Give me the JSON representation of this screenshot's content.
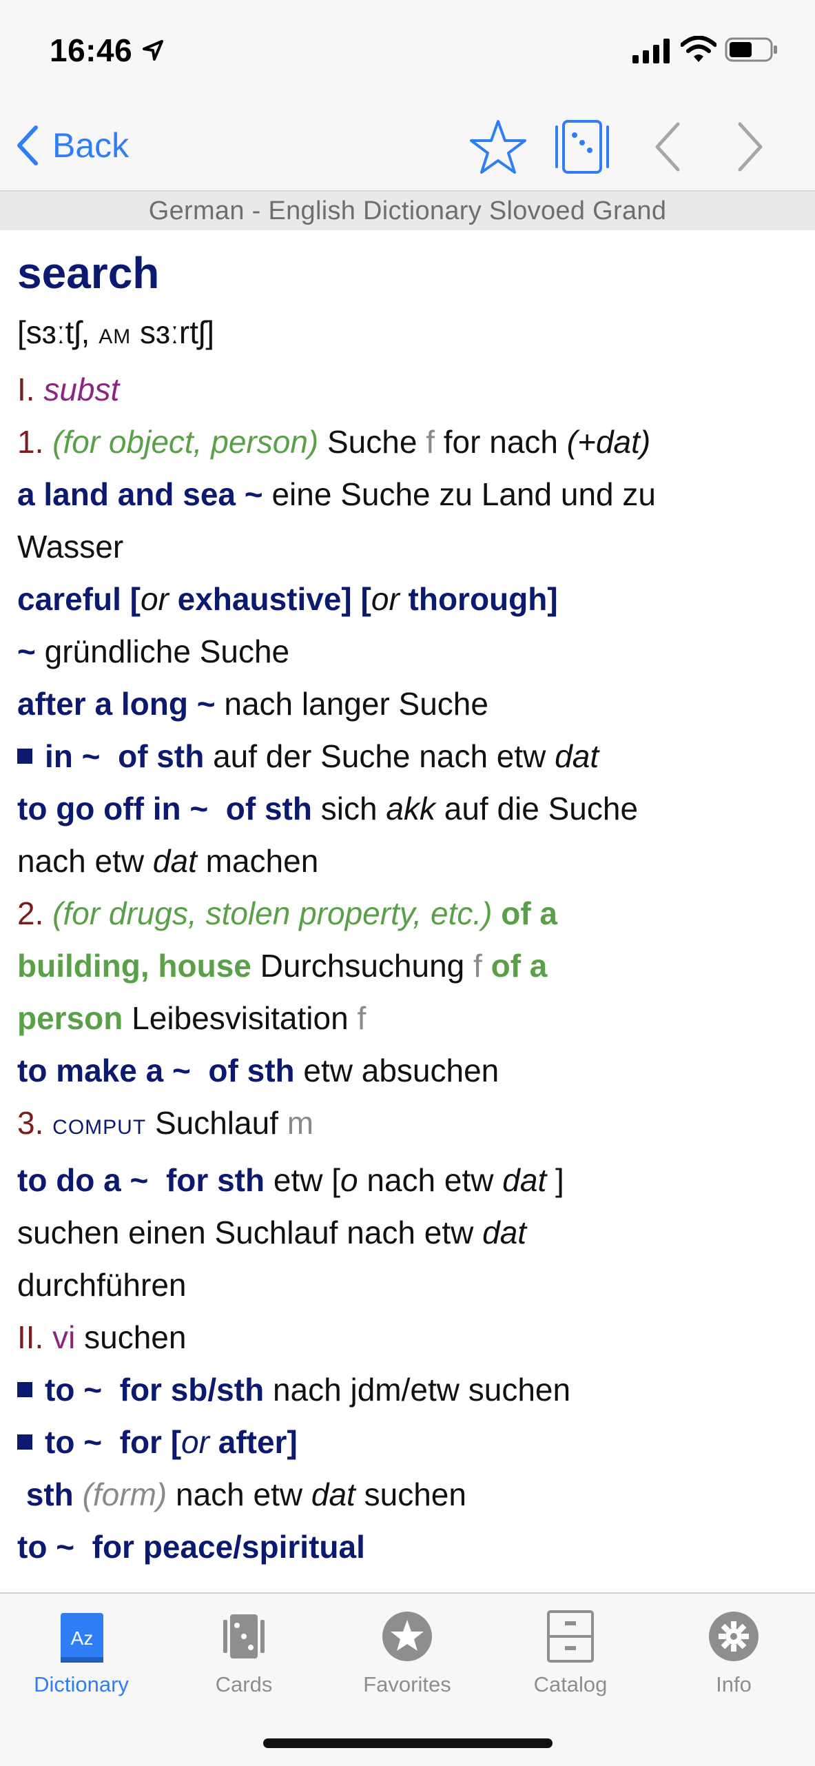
{
  "status": {
    "time": "16:46"
  },
  "nav": {
    "back_label": "Back"
  },
  "subtitle": "German - English Dictionary Slovoed Grand",
  "entry": {
    "headword": "search",
    "pron_a": "[sɜːtʃ, ",
    "pron_am": "AM",
    "pron_b": " sɜːrtʃ]",
    "s1_num": "I.",
    "s1_pos": "subst",
    "l1_num": "1.",
    "l1_ctx": "(for object, person)",
    "l1_tr": "Suche",
    "l1_g": "f",
    "l1_prep": "for nach",
    "l1_case": "(+dat)",
    "e1_b": "a land and sea ~",
    "e1_t": "eine Suche zu Land und zu",
    "e1_t2": "Wasser",
    "e2_b1": "careful [",
    "e2_or1": "or",
    "e2_b2": " exhaustive] [",
    "e2_or2": "or",
    "e2_b3": " thorough]",
    "e2_t_b": "~",
    "e2_t": "gründliche Suche",
    "e3_b": "after a long ~",
    "e3_t": "nach langer Suche",
    "e4_b1": "in ~",
    "e4_b2": "of sth",
    "e4_t": "auf der Suche nach etw",
    "e4_i": "dat",
    "e5_b1": "to go off in ~",
    "e5_b2": "of sth",
    "e5_t": "sich",
    "e5_i": "akk",
    "e5_t2": "auf die Suche",
    "e5_t3": "nach etw",
    "e5_i2": "dat",
    "e5_t4": "machen",
    "l2_num": "2.",
    "l2_ctx": "(for drugs, stolen property, etc.)",
    "l2_b1": "of a",
    "l2_b2": "building, house",
    "l2_tr": "Durchsuchung",
    "l2_g": "f",
    "l2_b3": "of a",
    "l2_b4": "person",
    "l2_tr2": "Leibesvisitation",
    "l2_g2": "f",
    "e6_b1": "to make a ~",
    "e6_b2": "of sth",
    "e6_t": "etw absuchen",
    "l3_num": "3.",
    "l3_lab": "COMPUT",
    "l3_tr": "Suchlauf",
    "l3_g": "m",
    "e7_b1": "to do a ~",
    "e7_b2": "for sth",
    "e7_t": "etw [",
    "e7_i": "o",
    "e7_t2": " nach etw",
    "e7_i2": "dat",
    "e7_t3": " ]",
    "e7_t4": "suchen einen Suchlauf nach etw",
    "e7_i3": "dat",
    "e7_t5": "durchführen",
    "s2_num": "II.",
    "s2_pos": "vi",
    "s2_tr": "suchen",
    "e8_b1": "to ~",
    "e8_b2": "for sb/sth",
    "e8_t": "nach jdm/etw suchen",
    "e9_b1": "to ~",
    "e9_b2": "for [",
    "e9_or": "or",
    "e9_b3": " after]",
    "e9_b4": "sth",
    "e9_ctx": "(form)",
    "e9_t": "nach etw",
    "e9_i": "dat",
    "e9_t2": "suchen",
    "e10_b1": "to ~",
    "e10_b2": "for peace/spiritual"
  },
  "tabs": [
    {
      "label": "Dictionary",
      "icon": "dictionary-icon",
      "active": true
    },
    {
      "label": "Cards",
      "icon": "cards-icon"
    },
    {
      "label": "Favorites",
      "icon": "favorites-icon"
    },
    {
      "label": "Catalog",
      "icon": "catalog-icon"
    },
    {
      "label": "Info",
      "icon": "info-icon"
    }
  ],
  "colors": {
    "accent": "#2f7ef5",
    "headword": "#0b1a6e",
    "context": "#5aa049",
    "pos": "#8b2680",
    "number": "#7a1d1d"
  }
}
